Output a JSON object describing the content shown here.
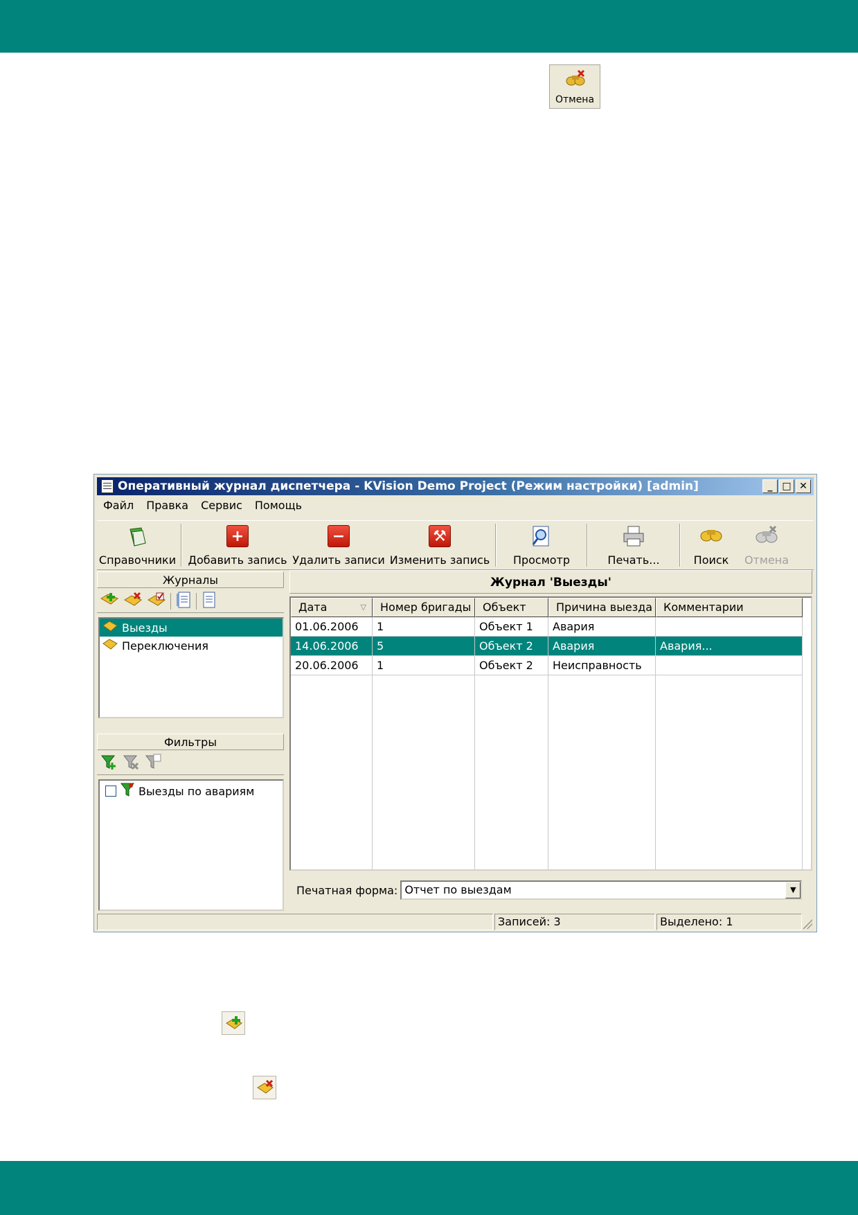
{
  "standalone_cancel": {
    "label": "Отмена"
  },
  "window": {
    "title": "Оперативный журнал диспетчера - KVision Demo Project (Режим настройки) [admin]",
    "controls": {
      "minimize": "_",
      "maximize": "□",
      "close": "✕"
    }
  },
  "menu": [
    "Файл",
    "Правка",
    "Сервис",
    "Помощь"
  ],
  "toolbar": {
    "directories": "Справочники",
    "add": "Добавить запись",
    "delete": "Удалить записи",
    "edit": "Изменить запись",
    "preview": "Просмотр",
    "print": "Печать...",
    "search": "Поиск",
    "cancel": "Отмена"
  },
  "journals": {
    "header": "Журналы",
    "items": [
      {
        "label": "Выезды",
        "selected": true
      },
      {
        "label": "Переключения",
        "selected": false
      }
    ]
  },
  "filters": {
    "header": "Фильтры",
    "items": [
      {
        "label": "Выезды по авариям",
        "checked": false
      }
    ]
  },
  "journal_view": {
    "title": "Журнал 'Выезды'",
    "columns": [
      "Дата",
      "Номер бригады",
      "Объект",
      "Причина выезда",
      "Комментарии"
    ],
    "rows": [
      [
        "01.06.2006",
        "1",
        "Объект 1",
        "Авария",
        ""
      ],
      [
        "14.06.2006",
        "5",
        "Объект 2",
        "Авария",
        "Авария..."
      ],
      [
        "20.06.2006",
        "1",
        "Объект 2",
        "Неисправность",
        ""
      ]
    ],
    "selected_row": 1
  },
  "print_form": {
    "label": "Печатная форма:",
    "value": "Отчет по выездам"
  },
  "status": {
    "records": "Записей: 3",
    "selected": "Выделено: 1"
  },
  "colors": {
    "accent": "#00847c",
    "selection": "#00847c"
  }
}
